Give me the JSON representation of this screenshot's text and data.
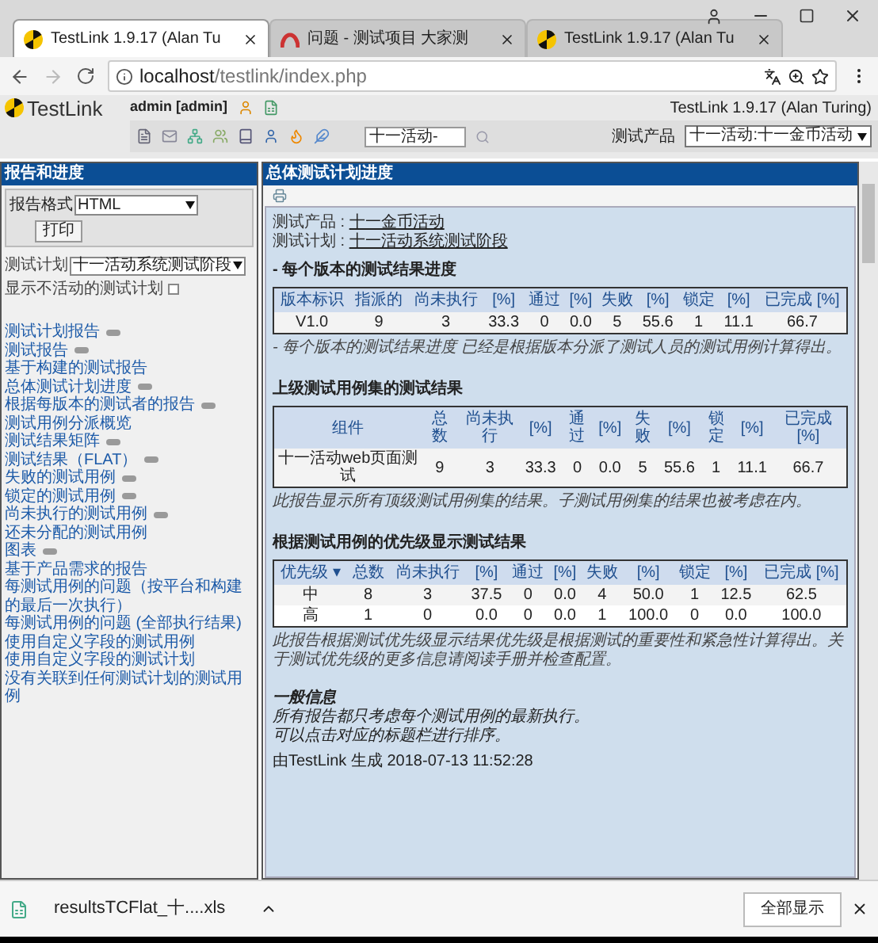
{
  "browser": {
    "tabs": [
      {
        "title": "TestLink 1.9.17 (Alan Tu",
        "selected": true
      },
      {
        "title": "问题 - 测试项目 大家测",
        "selected": false
      },
      {
        "title": "TestLink 1.9.17 (Alan Tu",
        "selected": false
      }
    ],
    "url_host": "localhost",
    "url_path": "/testlink/index.php"
  },
  "header": {
    "logo": "TestLink",
    "user": "admin [admin]",
    "version": "TestLink 1.9.17 (Alan Turing)",
    "search_value": "十一活动-",
    "product_label": "测试产品",
    "product_value": "十一活动:十一金币活动"
  },
  "sidebar": {
    "title": "报告和进度",
    "format_label": "报告格式",
    "format_value": "HTML",
    "print_button": "打印",
    "plan_label": "测试计划",
    "plan_value": "十一活动系统测试阶段",
    "inactive_label": "显示不活动的测试计划",
    "inactive_checked": false,
    "items": [
      {
        "label": "测试计划报告",
        "icon": true
      },
      {
        "label": "测试报告",
        "icon": true
      },
      {
        "label": "基于构建的测试报告",
        "icon": false
      },
      {
        "label": "总体测试计划进度",
        "icon": true
      },
      {
        "label": "根据每版本的测试者的报告",
        "icon": true
      },
      {
        "label": "测试用例分派概览",
        "icon": false
      },
      {
        "label": "测试结果矩阵",
        "icon": true
      },
      {
        "label": "测试结果（FLAT）",
        "icon": true
      },
      {
        "label": "失败的测试用例",
        "icon": true
      },
      {
        "label": "锁定的测试用例",
        "icon": true
      },
      {
        "label": "尚未执行的测试用例",
        "icon": true
      },
      {
        "label": "还未分配的测试用例",
        "icon": false
      },
      {
        "label": "图表",
        "icon": true
      },
      {
        "label": "基于产品需求的报告",
        "icon": false
      },
      {
        "label": "每测试用例的问题（按平台和构建的最后一次执行）",
        "icon": false
      },
      {
        "label": "每测试用例的问题 (全部执行结果)",
        "icon": false
      },
      {
        "label": "使用自定义字段的测试用例",
        "icon": false
      },
      {
        "label": "使用自定义字段的测试计划",
        "icon": false
      },
      {
        "label": "没有关联到任何测试计划的测试用例",
        "icon": false
      }
    ]
  },
  "main": {
    "title": "总体测试计划进度",
    "product_label": "测试产品 : ",
    "product_link": "十一金币活动",
    "plan_label": "测试计划 : ",
    "plan_link": "十一活动系统测试阶段",
    "sections": [
      {
        "heading": "- 每个版本的测试结果进度",
        "columns": [
          "版本标识",
          "指派的",
          "尚未执行",
          "[%]",
          "通过",
          "[%]",
          "失败",
          "[%]",
          "锁定",
          "[%]",
          "已完成 [%]"
        ],
        "rows": [
          [
            "V1.0",
            "9",
            "3",
            "33.3",
            "0",
            "0.0",
            "5",
            "55.6",
            "1",
            "11.1",
            "66.7"
          ]
        ],
        "note": "- 每个版本的测试结果进度 已经是根据版本分派了测试人员的测试用例计算得出。"
      },
      {
        "heading": "上级测试用例集的测试结果",
        "columns": [
          "组件",
          "总数",
          "尚未执行",
          "[%]",
          "通过",
          "[%]",
          "失败",
          "[%]",
          "锁定",
          "[%]",
          "已完成 [%]"
        ],
        "rows": [
          [
            "十一活动web页面测试",
            "9",
            "3",
            "33.3",
            "0",
            "0.0",
            "5",
            "55.6",
            "1",
            "11.1",
            "66.7"
          ]
        ],
        "note": "此报告显示所有顶级测试用例集的结果。子测试用例集的结果也被考虑在内。"
      },
      {
        "heading": "根据测试用例的优先级显示测试结果",
        "columns": [
          "优先级 ▾",
          "总数",
          "尚未执行",
          "[%]",
          "通过",
          "[%]",
          "失败",
          "[%]",
          "锁定",
          "[%]",
          "已完成 [%]"
        ],
        "rows": [
          [
            "中",
            "8",
            "3",
            "37.5",
            "0",
            "0.0",
            "4",
            "50.0",
            "1",
            "12.5",
            "62.5"
          ],
          [
            "高",
            "1",
            "0",
            "0.0",
            "0",
            "0.0",
            "1",
            "100.0",
            "0",
            "0.0",
            "100.0"
          ]
        ],
        "note": "此报告根据测试优先级显示结果优先级是根据测试的重要性和紧急性计算得出。关于测试优先级的更多信息请阅读手册并检查配置。"
      }
    ],
    "general_title": "一般信息",
    "general_lines": [
      "所有报告都只考虑每个测试用例的最新执行。",
      "可以点击对应的标题栏进行排序。"
    ],
    "generated": "由TestLink 生成 2018-07-13 11:52:28"
  },
  "downloads": {
    "file": "resultsTCFlat_十....xls",
    "show_all": "全部显示"
  }
}
